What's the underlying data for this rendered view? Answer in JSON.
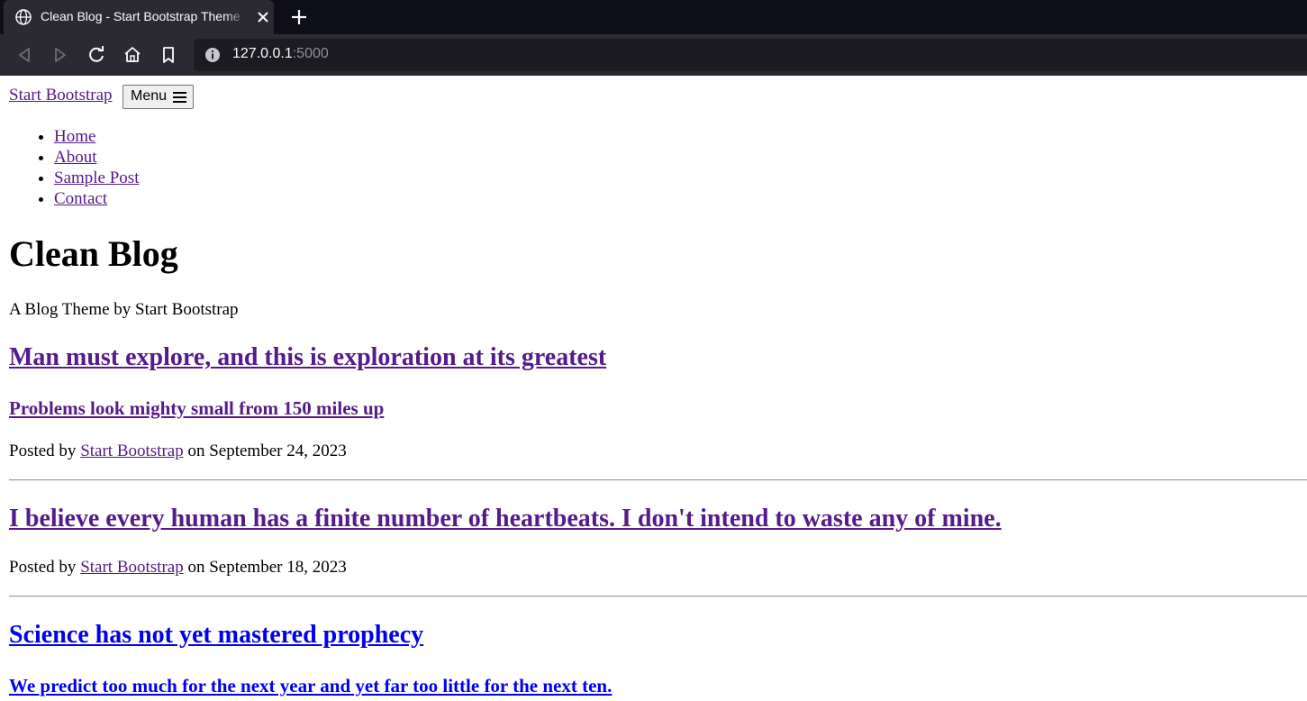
{
  "browser": {
    "tab_title": "Clean Blog - Start Bootstrap Theme",
    "url_host": "127.0.0.1",
    "url_port": ":5000",
    "icons": [
      "globe-icon",
      "close-icon",
      "plus-icon",
      "back-icon",
      "forward-icon",
      "reload-icon",
      "home-icon",
      "bookmark-icon",
      "info-icon"
    ]
  },
  "nav": {
    "brand": "Start Bootstrap",
    "menu_label": "Menu",
    "items": [
      "Home",
      "About",
      "Sample Post",
      "Contact"
    ]
  },
  "header": {
    "title": "Clean Blog",
    "subtitle": "A Blog Theme by Start Bootstrap"
  },
  "posts": [
    {
      "title": "Man must explore, and this is exploration at its greatest",
      "subtitle": "Problems look mighty small from 150 miles up",
      "meta_prefix": "Posted by",
      "author": "Start Bootstrap",
      "meta_date": "on September 24, 2023"
    },
    {
      "title": "I believe every human has a finite number of heartbeats. I don't intend to waste any of mine.",
      "meta_prefix": "Posted by",
      "author": "Start Bootstrap",
      "meta_date": "on September 18, 2023"
    },
    {
      "title": "Science has not yet mastered prophecy",
      "subtitle": "We predict too much for the next year and yet far too little for the next ten."
    }
  ],
  "colors": {
    "visited_link": "#551a8b",
    "unvisited_link": "#0000ee",
    "chrome_dark": "#2b2a33",
    "tabbar": "#0f0f1a"
  }
}
